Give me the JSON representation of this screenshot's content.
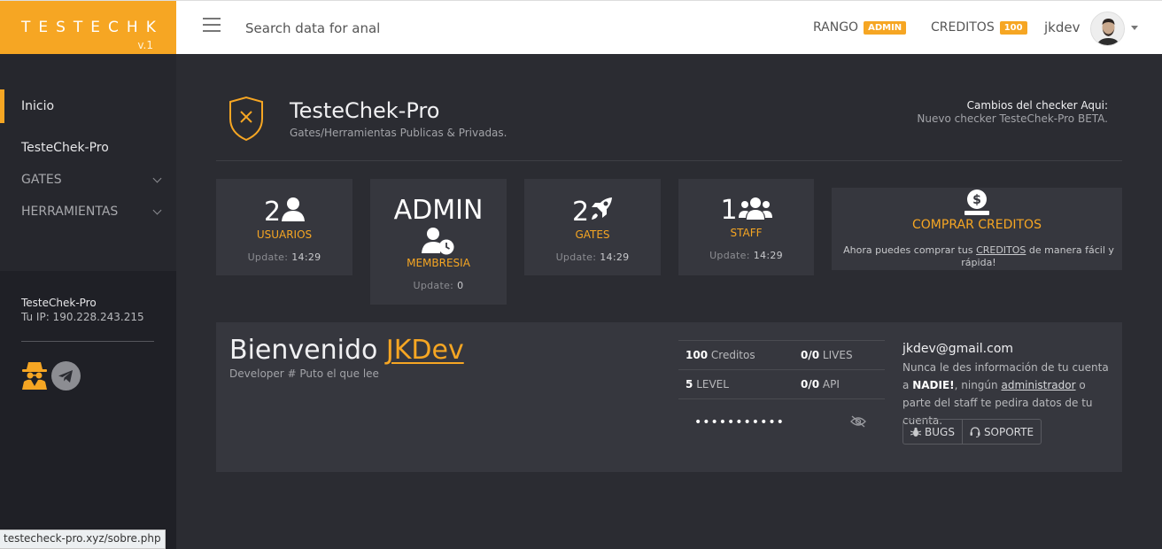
{
  "brand": {
    "name": "TESTECHK",
    "version": "v.1",
    "color": "#f6a623"
  },
  "search": {
    "placeholder": "Search data for analy"
  },
  "header": {
    "rank_label": "RANGO",
    "rank_value": "ADMIN",
    "credits_label": "CREDITOS",
    "credits_value": "100",
    "username": "jkdev"
  },
  "sidebar": {
    "items": [
      {
        "label": "Inicio"
      },
      {
        "label": "TesteChek-Pro"
      },
      {
        "label": "GATES"
      },
      {
        "label": "HERRAMIENTAS"
      }
    ],
    "info_title": "TesteChek-Pro",
    "info_ip": "Tu IP: 190.228.243.215"
  },
  "main": {
    "title": "TesteChek-Pro",
    "subtitle": "Gates/Herramientas Publicas & Privadas.",
    "changes_title": "Cambios del checker Aqui:",
    "changes_text": "Nuevo checker TesteChek-Pro BETA."
  },
  "stats": {
    "users": {
      "value": "2",
      "label": "USUARIOS",
      "upd_label": "Update:",
      "upd_value": "14:29"
    },
    "membership": {
      "value": "ADMIN",
      "label": "MEMBRESIA",
      "upd_label": "Update:",
      "upd_value": "0"
    },
    "gates": {
      "value": "2",
      "label": "GATES",
      "upd_label": "Update:",
      "upd_value": "14:29"
    },
    "staff": {
      "value": "1",
      "label": "STAFF",
      "upd_label": "Update:",
      "upd_value": "14:29"
    }
  },
  "buy": {
    "title": "COMPRAR CREDITOS",
    "text_before": "Ahora puedes comprar tus",
    "text_link": "CREDITOS",
    "text_after": "de manera fácil y rápida!"
  },
  "welcome": {
    "greeting": "Bienvenido",
    "name": "JKDev",
    "role": "Developer # Puto el que lee",
    "credits_num": "100",
    "credits_label": "Creditos",
    "lives_num": "0/0",
    "lives_label": "LIVES",
    "level_num": "5",
    "level_label": "LEVEL",
    "api_num": "0/0",
    "api_label": "API",
    "password_mask": "•••••••••••",
    "email": "jkdev@gmail.com",
    "note_1": "Nunca le des información de tu cuenta a",
    "note_bold": "NADIE!",
    "note_2": ", ningún",
    "note_link": "administrador",
    "note_3": "o parte del staff te pedira datos de tu cuenta.",
    "bugs_label": "BUGS",
    "support_label": "SOPORTE"
  },
  "statusbar": {
    "url": "testecheck-pro.xyz/sobre.php"
  }
}
